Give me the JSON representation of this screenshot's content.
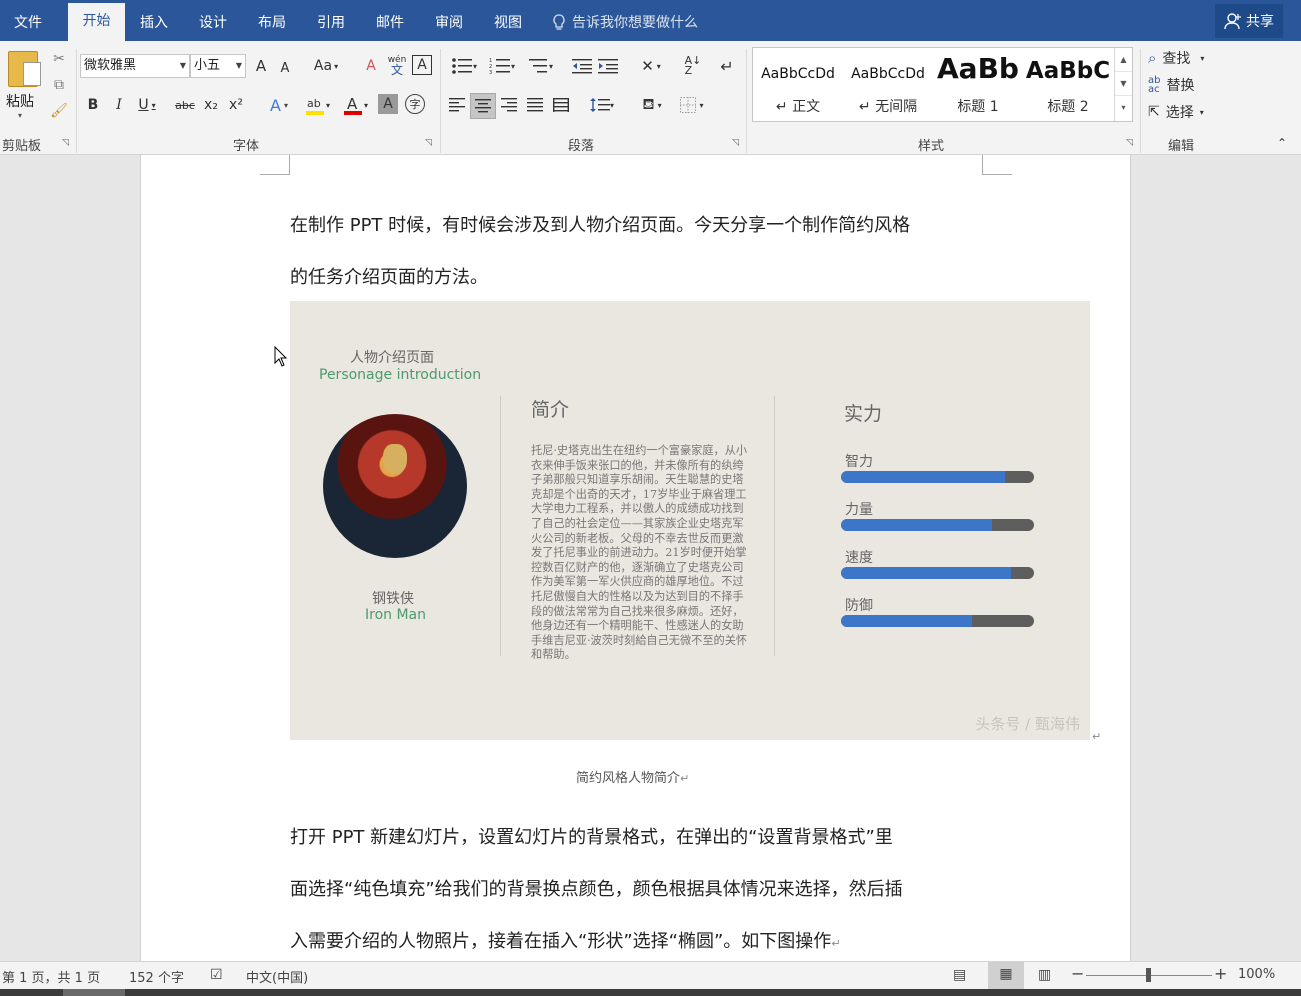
{
  "tabs": [
    {
      "label": "文件"
    },
    {
      "label": "开始",
      "active": true
    },
    {
      "label": "插入"
    },
    {
      "label": "设计"
    },
    {
      "label": "布局"
    },
    {
      "label": "引用"
    },
    {
      "label": "邮件"
    },
    {
      "label": "审阅"
    },
    {
      "label": "视图"
    }
  ],
  "tell_me": "告诉我你想要做什么",
  "share_label": "共享",
  "ribbon": {
    "clipboard": {
      "paste_label": "粘贴",
      "group_label": "剪贴板"
    },
    "font": {
      "font_name": "微软雅黑",
      "font_size": "小五",
      "change_case": "Aa",
      "group_label": "字体",
      "bold": "B",
      "italic": "I",
      "underline": "U",
      "strike": "abc",
      "subscript": "x₂",
      "superscript": "x²",
      "grow": "A",
      "shrink": "A",
      "clear": "A",
      "phonetic": "wén",
      "border_char": "A"
    },
    "paragraph": {
      "group_label": "段落"
    },
    "styles": {
      "group_label": "样式",
      "items": [
        {
          "preview": "AaBbCcDd",
          "name": "↵ 正文"
        },
        {
          "preview": "AaBbCcDd",
          "name": "↵ 无间隔"
        },
        {
          "preview": "AaBb",
          "name": "标题 1"
        },
        {
          "preview": "AaBbC",
          "name": "标题 2"
        }
      ]
    },
    "editing": {
      "group_label": "编辑",
      "find": "查找",
      "replace": "替换",
      "select": "选择"
    }
  },
  "document": {
    "para1_line1": "在制作 PPT 时候，有时候会涉及到人物介绍页面。今天分享一个制作简约风格",
    "para1_line2": "的任务介绍页面的方法。",
    "caption": "简约风格人物简介",
    "para2_line1": "打开 PPT 新建幻灯片，设置幻灯片的背景格式，在弹出的“设置背景格式”里",
    "para2_line2": "面选择“纯色填充”给我们的背景换点颜色，颜色根据具体情况来选择，然后插",
    "para2_line3": "入需要介绍的人物照片，接着在插入“形状”选择“椭圆”。如下图操作",
    "slide": {
      "title_cn": "人物介绍页面",
      "title_en": "Personage introduction",
      "name_cn": "钢铁侠",
      "name_en": "Iron Man",
      "intro_heading": "简介",
      "intro_text": "托尼·史塔克出生在纽约一个富豪家庭，从小衣来伸手饭来张口的他，并未像所有的纨绔子弟那般只知道享乐胡闹。天生聪慧的史塔克却是个出奇的天才，17岁毕业于麻省理工大学电力工程系，并以傲人的成绩成功找到了自己的社会定位——其家族企业史塔克军火公司的新老板。父母的不幸去世反而更激发了托尼事业的前进动力。21岁时便开始掌控数百亿财产的他，逐渐确立了史塔克公司作为美军第一军火供应商的雄厚地位。不过托尼傲慢自大的性格以及为达到目的不择手段的做法常常为自己找来很多麻烦。还好，他身边还有一个精明能干、性感迷人的女助手维吉尼亚·波茨时刻給自己无微不至的关怀和帮助。",
      "stats_heading": "实力",
      "stats": [
        {
          "label": "智力",
          "value": 0.85
        },
        {
          "label": "力量",
          "value": 0.78
        },
        {
          "label": "速度",
          "value": 0.88
        },
        {
          "label": "防御",
          "value": 0.68
        }
      ],
      "watermark": "头条号 / 甄海伟"
    }
  },
  "statusbar": {
    "page": "第 1 页，共 1 页",
    "words": "152 个字",
    "language": "中文(中国)",
    "zoom": "100%"
  }
}
